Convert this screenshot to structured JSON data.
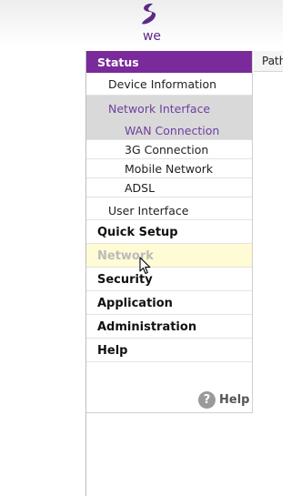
{
  "brand": {
    "logo_text": "we",
    "logo_color": "#5b2a86"
  },
  "sidebar": {
    "status_label": "Status",
    "device_information": "Device Information",
    "network_interface": "Network Interface",
    "wan_connection": "WAN Connection",
    "g3_connection": "3G Connection",
    "mobile_network": "Mobile Network",
    "adsl": "ADSL",
    "user_interface": "User Interface",
    "quick_setup": "Quick Setup",
    "network": "Network",
    "security": "Security",
    "application": "Application",
    "administration": "Administration",
    "help": "Help"
  },
  "help_button": {
    "icon_glyph": "?",
    "label": "Help"
  },
  "main": {
    "path_label": "Path"
  },
  "colors": {
    "accent": "#7a2a9a",
    "selected_text": "#6e3fa0",
    "selected_bg": "#d9d9d9",
    "hover_bg": "#fffbd4"
  },
  "icons": {
    "logo": "we-logo-icon",
    "help": "question-mark-icon",
    "cursor": "mouse-pointer-icon"
  }
}
